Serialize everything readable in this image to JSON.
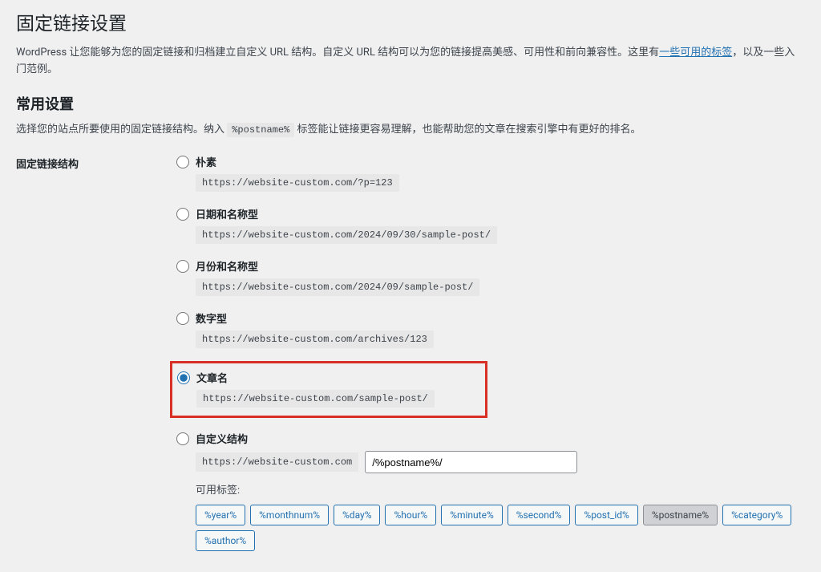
{
  "page": {
    "title": "固定链接设置",
    "intro_before": "WordPress 让您能够为您的固定链接和归档建立自定义 URL 结构。自定义 URL 结构可以为您的链接提高美感、可用性和前向兼容性。这里有",
    "intro_link": "一些可用的标签",
    "intro_after": "，以及一些入门范例。"
  },
  "section": {
    "heading": "常用设置",
    "desc_before": "选择您的站点所要使用的固定链接结构。纳入 ",
    "desc_code": "%postname%",
    "desc_after": " 标签能让链接更容易理解，也能帮助您的文章在搜索引擎中有更好的排名。"
  },
  "form": {
    "label": "固定链接结构",
    "options": [
      {
        "label": "朴素",
        "example": "https://website-custom.com/?p=123"
      },
      {
        "label": "日期和名称型",
        "example": "https://website-custom.com/2024/09/30/sample-post/"
      },
      {
        "label": "月份和名称型",
        "example": "https://website-custom.com/2024/09/sample-post/"
      },
      {
        "label": "数字型",
        "example": "https://website-custom.com/archives/123"
      },
      {
        "label": "文章名",
        "example": "https://website-custom.com/sample-post/"
      },
      {
        "label": "自定义结构"
      }
    ],
    "selected_index": 4,
    "custom": {
      "prefix": "https://website-custom.com",
      "value": "/%postname%/"
    },
    "tags_label": "可用标签:",
    "tags": [
      "%year%",
      "%monthnum%",
      "%day%",
      "%hour%",
      "%minute%",
      "%second%",
      "%post_id%",
      "%postname%",
      "%category%",
      "%author%"
    ],
    "active_tag": "%postname%"
  }
}
